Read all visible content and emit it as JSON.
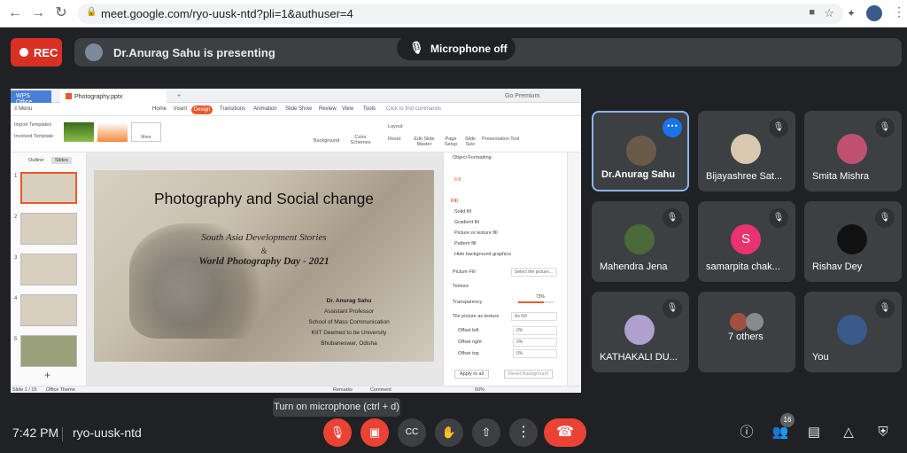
{
  "browser": {
    "url": "meet.google.com/ryo-uusk-ntd?pli=1&authuser=4",
    "back_icon": "arrow-left-icon",
    "forward_icon": "arrow-right-icon",
    "reload_icon": "reload-icon"
  },
  "meet": {
    "rec_label": "REC",
    "presenting_text": "Dr.Anurag Sahu is presenting",
    "mic_off_banner": "Microphone off",
    "time": "7:42 PM",
    "meeting_code": "ryo-uusk-ntd",
    "tooltip": "Turn on microphone (ctrl + d)",
    "participant_count": "16",
    "colors": {
      "rec": "#d93025",
      "end_call": "#ea4335",
      "active_border": "#8ab4f8",
      "bg": "#202124",
      "tile": "#3c4043"
    }
  },
  "participants": [
    {
      "name": "Dr.Anurag Sahu",
      "avatar_color": "#6a5a4a",
      "active": true
    },
    {
      "name": "Bijayashree Sat...",
      "avatar_color": "#d8c8b0"
    },
    {
      "name": "Smita Mishra",
      "avatar_color": "#c05070"
    },
    {
      "name": "Mahendra Jena",
      "avatar_color": "#4a6a3a"
    },
    {
      "name": "samarpita chak...",
      "avatar_color": "#e8336e",
      "initial": "S"
    },
    {
      "name": "Rishav Dey",
      "avatar_color": "#111111"
    },
    {
      "name": "KATHAKALI DU...",
      "avatar_color": "#b0a0d0"
    },
    {
      "name": "7 others",
      "avatar_color": "#a05040"
    },
    {
      "name": "You",
      "avatar_color": "#3a5a8a"
    }
  ],
  "wps": {
    "app_tab": "WPS Office",
    "file_tab": "Photography.pptx",
    "go_premium": "Go Premium",
    "menu_label": "Menu",
    "ribbon_tabs": [
      "Home",
      "Insert",
      "Design",
      "Transitions",
      "Animation",
      "Slide Show",
      "Review",
      "View",
      "Tools"
    ],
    "search_placeholder": "Click to find commands",
    "import_templates": "Import Templates",
    "involved_template": "Involved Template",
    "more_label": "More",
    "background_label": "Background",
    "color_schemes_label": "Color Schemes",
    "layout_label": "Layout",
    "reset_label": "Reset",
    "edit_slide_master": "Edit Slide Master",
    "page_setup": "Page Setup",
    "slide_size": "Slide Size",
    "presentation_tool": "Presentation Tool",
    "outline_tab": "Outline",
    "slides_tab": "Slides",
    "slide_numbers": [
      "1",
      "2",
      "3",
      "4",
      "5"
    ],
    "status_slide": "Slide 1 / 15",
    "status_theme": "Office Theme",
    "remarks": "Remarks",
    "comment": "Comment",
    "zoom": "50%"
  },
  "slide": {
    "title": "Photography and Social change",
    "subtitle1": "South Asia Development Stories",
    "amp": "&",
    "subtitle2": "World Photography Day - 2021",
    "author_name": "Dr. Anurag Sahu",
    "author_role": "Assistant Professor",
    "author_school": "School of Mass Communication",
    "author_univ": "KIIT Deemed to be University",
    "author_place": "Bhubaneswar, Odisha"
  },
  "object_panel": {
    "title": "Object Formatting",
    "fill_tab": "Fill",
    "fill_header": "Fill",
    "options": [
      "Solid fill",
      "Gradient fill",
      "Picture or texture fill",
      "Pattern fill",
      "Hide background graphics"
    ],
    "picture_fill": "Picture Fill",
    "picture_fill_value": "Select the picture...",
    "texture": "Texture",
    "transparency": "Transparency",
    "transparency_value": "73%",
    "tile_label": "Tile picture as texture",
    "tile_value": "As Fill",
    "offset_left": "Offset left",
    "offset_right": "Offset right",
    "offset_top": "Offset top",
    "offset_value": "0%",
    "apply_all": "Apply to all",
    "reset_background": "Reset Background"
  }
}
